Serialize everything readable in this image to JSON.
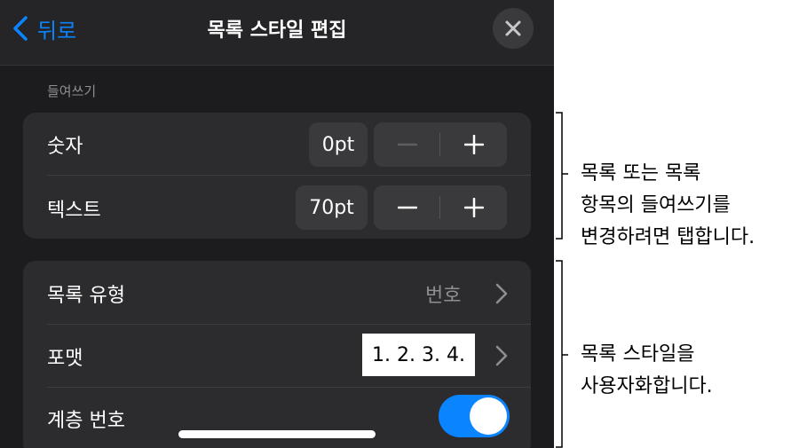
{
  "navbar": {
    "back_label": "뒤로",
    "title": "목록 스타일 편집",
    "back_icon": "chevron-left-icon",
    "close_icon": "close-icon"
  },
  "indent_section": {
    "label": "들여쓰기",
    "rows": [
      {
        "label": "숫자",
        "value": "0pt"
      },
      {
        "label": "텍스트",
        "value": "70pt"
      }
    ]
  },
  "style_section": {
    "list_type": {
      "label": "목록 유형",
      "value": "번호"
    },
    "format": {
      "label": "포맷",
      "value": "1. 2. 3. 4."
    },
    "tiered_numbers": {
      "label": "계층 번호",
      "on": true
    }
  },
  "callouts": [
    {
      "lines": [
        "목록 또는 목록",
        "항목의 들여쓰기를",
        "변경하려면 탭합니다."
      ]
    },
    {
      "lines": [
        "목록 스타일을",
        "사용자화합니다."
      ]
    }
  ],
  "colors": {
    "accent": "#0a84ff",
    "panel_bg": "#1c1c1e",
    "group_bg": "#2c2c2e"
  }
}
